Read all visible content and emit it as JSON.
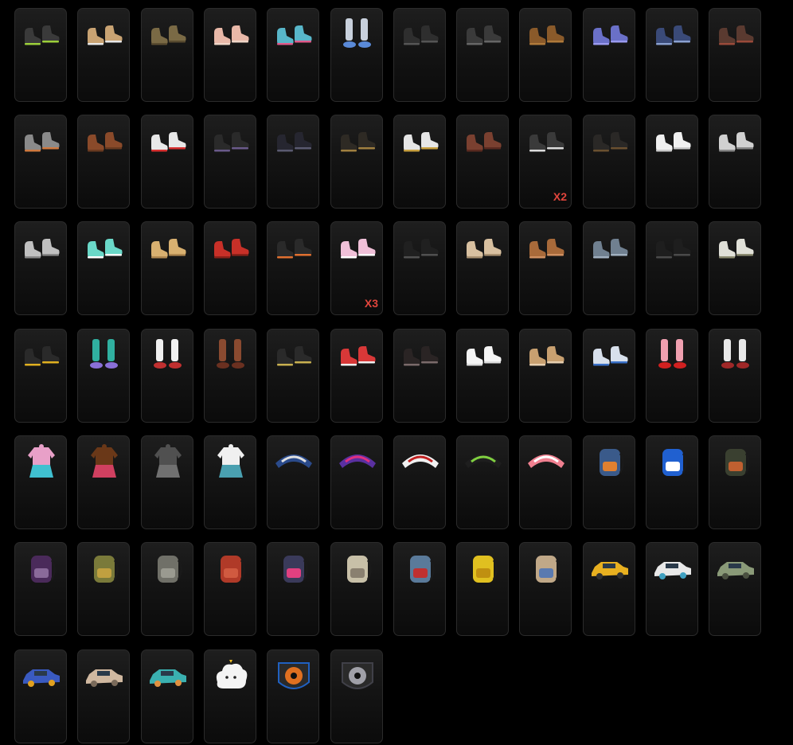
{
  "inventory": {
    "columns": 12,
    "items": [
      {
        "kind": "shoes",
        "icon": "black-green-sneakers-icon",
        "color": "#3a3a3a",
        "accent": "#9ccf3a"
      },
      {
        "kind": "shoes",
        "icon": "tan-boots-icon",
        "color": "#c9a373",
        "accent": "#e8e8e8"
      },
      {
        "kind": "shoes",
        "icon": "brown-combat-boots-icon",
        "color": "#7a6a45",
        "accent": "#5a4c30"
      },
      {
        "kind": "shoes",
        "icon": "pink-sandals-icon",
        "color": "#e8b8a8",
        "accent": "#f0d6c8"
      },
      {
        "kind": "shoes",
        "icon": "blue-slippers-icon",
        "color": "#58b6c9",
        "accent": "#e05a8a"
      },
      {
        "kind": "socks",
        "icon": "white-stockings-icon",
        "color": "#c8d0dc",
        "accent": "#5a8ad8"
      },
      {
        "kind": "shoes",
        "icon": "black-loafers-icon",
        "color": "#2e2e2e",
        "accent": "#555555"
      },
      {
        "kind": "shoes",
        "icon": "dark-loafers-icon",
        "color": "#3a3a3a",
        "accent": "#666666"
      },
      {
        "kind": "shoes",
        "icon": "brown-gloves-shoes-icon",
        "color": "#8a5a2a",
        "accent": "#b07a3a"
      },
      {
        "kind": "shoes",
        "icon": "purple-heels-icon",
        "color": "#6a70c8",
        "accent": "#9a9af0"
      },
      {
        "kind": "shoes",
        "icon": "navy-sneakers-icon",
        "color": "#3a4a78",
        "accent": "#8aa0d0"
      },
      {
        "kind": "shoes",
        "icon": "red-brown-boots-icon",
        "color": "#5a3a30",
        "accent": "#9a4a3a"
      },
      {
        "kind": "shoes",
        "icon": "gray-orange-sneakers-icon",
        "color": "#8a8a8a",
        "accent": "#d07a40"
      },
      {
        "kind": "shoes",
        "icon": "brown-tall-boots-icon",
        "color": "#8a4a2a",
        "accent": "#6a3a20"
      },
      {
        "kind": "shoes",
        "icon": "white-red-sneakers-icon",
        "color": "#e8e8e8",
        "accent": "#d83030"
      },
      {
        "kind": "shoes",
        "icon": "black-ankle-boots-icon",
        "color": "#2a2a2a",
        "accent": "#6a5a8a"
      },
      {
        "kind": "shoes",
        "icon": "black-shoes-icon",
        "color": "#262630",
        "accent": "#5a5a70"
      },
      {
        "kind": "shoes",
        "icon": "black-gold-boots-icon",
        "color": "#2e2a24",
        "accent": "#a08040"
      },
      {
        "kind": "shoes",
        "icon": "white-gold-boots-icon",
        "color": "#e6e6e6",
        "accent": "#c8a040"
      },
      {
        "kind": "shoes",
        "icon": "brown-thigh-boots-icon",
        "color": "#7a4030",
        "accent": "#5a2a20"
      },
      {
        "kind": "shoes",
        "icon": "black-white-sneakers-icon",
        "color": "#3a3a3a",
        "accent": "#dcdcdc",
        "badge": "X2"
      },
      {
        "kind": "shoes",
        "icon": "black-boots-icon",
        "color": "#2a2826",
        "accent": "#6a5030"
      },
      {
        "kind": "shoes",
        "icon": "white-flats-icon",
        "color": "#f0f0f0",
        "accent": "#cccccc"
      },
      {
        "kind": "shoes",
        "icon": "white-high-boots-icon",
        "color": "#d0d0d0",
        "accent": "#888888"
      },
      {
        "kind": "shoes",
        "icon": "gray-sneakers-icon",
        "color": "#c0c0c0",
        "accent": "#888888"
      },
      {
        "kind": "shoes",
        "icon": "mint-slides-icon",
        "color": "#6ad8c8",
        "accent": "#ffffff"
      },
      {
        "kind": "shoes",
        "icon": "tan-sneakers-icon",
        "color": "#d8b070",
        "accent": "#b08850"
      },
      {
        "kind": "shoes",
        "icon": "red-boots-icon",
        "color": "#c83028",
        "accent": "#8a2018"
      },
      {
        "kind": "shoes",
        "icon": "black-orange-sneakers-icon",
        "color": "#2a2a2a",
        "accent": "#e07030"
      },
      {
        "kind": "shoes",
        "icon": "pink-socks-white-shoes-icon",
        "color": "#f0c0d8",
        "accent": "#ffffff",
        "badge": "X3"
      },
      {
        "kind": "shoes",
        "icon": "black-leather-boots-icon",
        "color": "#202020",
        "accent": "#505050"
      },
      {
        "kind": "shoes",
        "icon": "beige-fur-boots-icon",
        "color": "#d8c0a0",
        "accent": "#a89070"
      },
      {
        "kind": "shoes",
        "icon": "brown-moccasins-icon",
        "color": "#a86a3a",
        "accent": "#d09060"
      },
      {
        "kind": "shoes",
        "icon": "slate-boots-icon",
        "color": "#708090",
        "accent": "#a0b0c0"
      },
      {
        "kind": "shoes",
        "icon": "black-combat-boots-icon",
        "color": "#1e1e1e",
        "accent": "#4a4a4a"
      },
      {
        "kind": "shoes",
        "icon": "white-camo-slides-icon",
        "color": "#e0e0d8",
        "accent": "#8a8a70"
      },
      {
        "kind": "shoes",
        "icon": "black-yellow-boots-icon",
        "color": "#2a2a2a",
        "accent": "#e0b020"
      },
      {
        "kind": "socks",
        "icon": "checkered-socks-purple-shoes-icon",
        "color": "#30b0a0",
        "accent": "#8a70d8"
      },
      {
        "kind": "socks",
        "icon": "striped-socks-sandals-icon",
        "color": "#f0f0f0",
        "accent": "#c03030"
      },
      {
        "kind": "socks",
        "icon": "brown-stockings-icon",
        "color": "#8a4a30",
        "accent": "#6a3020"
      },
      {
        "kind": "shoes",
        "icon": "black-heels-icon",
        "color": "#2a2a2a",
        "accent": "#c8b050"
      },
      {
        "kind": "shoes",
        "icon": "red-white-sneakers-icon",
        "color": "#d83838",
        "accent": "#f0f0f0"
      },
      {
        "kind": "shoes",
        "icon": "black-lace-boots-icon",
        "color": "#2a2424",
        "accent": "#7a6a6a"
      },
      {
        "kind": "shoes",
        "icon": "white-sneakers-icon",
        "color": "#f4f4f4",
        "accent": "#dddddd"
      },
      {
        "kind": "shoes",
        "icon": "tan-strap-sandals-icon",
        "color": "#c8a070",
        "accent": "#e8d0b0"
      },
      {
        "kind": "shoes",
        "icon": "blue-white-sneakers-icon",
        "color": "#d8e0ec",
        "accent": "#3a70c8"
      },
      {
        "kind": "socks",
        "icon": "pink-socks-red-shoes-icon",
        "color": "#f0a0b0",
        "accent": "#d02020"
      },
      {
        "kind": "socks",
        "icon": "white-socks-red-shoes-icon",
        "color": "#e8e8e8",
        "accent": "#a02828"
      },
      {
        "kind": "outfit",
        "icon": "pink-jacket-skirt-icon",
        "color": "#e8a0c8",
        "accent": "#40c0d0"
      },
      {
        "kind": "outfit",
        "icon": "brown-jumpsuit-icon",
        "color": "#6a3818",
        "accent": "#d04060"
      },
      {
        "kind": "outfit",
        "icon": "gray-tactical-suit-icon",
        "color": "#505050",
        "accent": "#707070"
      },
      {
        "kind": "outfit",
        "icon": "white-top-sequin-skirt-icon",
        "color": "#f0f0f0",
        "accent": "#4aa0b0"
      },
      {
        "kind": "glider",
        "icon": "blue-glider-icon",
        "color": "#2a4a8a",
        "accent": "#e0e0e0"
      },
      {
        "kind": "glider",
        "icon": "purple-floral-glider-icon",
        "color": "#5a30a0",
        "accent": "#e03080"
      },
      {
        "kind": "glider",
        "icon": "white-graffiti-glider-icon",
        "color": "#f0f0f0",
        "accent": "#c02020"
      },
      {
        "kind": "glider",
        "icon": "black-green-glider-icon",
        "color": "#1e1e1e",
        "accent": "#80d040"
      },
      {
        "kind": "glider",
        "icon": "pink-cartoon-glider-icon",
        "color": "#f08090",
        "accent": "#ffffff"
      },
      {
        "kind": "backpack",
        "icon": "blue-orange-backpack-icon",
        "color": "#3a5a8a",
        "accent": "#e08030"
      },
      {
        "kind": "backpack",
        "icon": "blue-white-backpack-icon",
        "color": "#2060d0",
        "accent": "#ffffff"
      },
      {
        "kind": "backpack",
        "icon": "dark-camo-backpack-icon",
        "color": "#3a4030",
        "accent": "#c06030"
      },
      {
        "kind": "backpack",
        "icon": "purple-backpack-icon",
        "color": "#4a2a5a",
        "accent": "#8a6a9a"
      },
      {
        "kind": "backpack",
        "icon": "olive-patched-backpack-icon",
        "color": "#7a7a3a",
        "accent": "#c0a040"
      },
      {
        "kind": "backpack",
        "icon": "gray-backpack-icon",
        "color": "#707068",
        "accent": "#9a9a90"
      },
      {
        "kind": "backpack",
        "icon": "red-backpack-icon",
        "color": "#b03a28",
        "accent": "#d05a40"
      },
      {
        "kind": "backpack",
        "icon": "graffiti-backpack-icon",
        "color": "#3a3a5a",
        "accent": "#e04080"
      },
      {
        "kind": "backpack",
        "icon": "beige-backpack-icon",
        "color": "#c8c0a8",
        "accent": "#8a8070"
      },
      {
        "kind": "backpack",
        "icon": "shark-backpack-icon",
        "color": "#5a7a9a",
        "accent": "#c03030"
      },
      {
        "kind": "backpack",
        "icon": "yellow-backpack-icon",
        "color": "#e0c020",
        "accent": "#c09010"
      },
      {
        "kind": "backpack",
        "icon": "striped-sack-backpack-icon",
        "color": "#c0a888",
        "accent": "#5a7ab0"
      },
      {
        "kind": "vehicle",
        "icon": "yellow-taxi-car-icon",
        "color": "#e8b020",
        "accent": "#303030"
      },
      {
        "kind": "vehicle",
        "icon": "white-bus-icon",
        "color": "#e8e8e8",
        "accent": "#40a0c0"
      },
      {
        "kind": "vehicle",
        "icon": "olive-jeep-icon",
        "color": "#8a9a78",
        "accent": "#4a5040"
      },
      {
        "kind": "vehicle",
        "icon": "blue-graffiti-car-icon",
        "color": "#3a5ac0",
        "accent": "#e0a020"
      },
      {
        "kind": "vehicle",
        "icon": "beige-sedan-icon",
        "color": "#d0b8a0",
        "accent": "#7a6a5a"
      },
      {
        "kind": "vehicle",
        "icon": "teal-speedboat-icon",
        "color": "#3ab0b0",
        "accent": "#e09040"
      },
      {
        "kind": "pendant",
        "icon": "cloud-charm-icon",
        "color": "#f4f4f4",
        "accent": "#f0c020"
      },
      {
        "kind": "emblem",
        "icon": "flaming-wheel-emblem-icon",
        "color": "#e07020",
        "accent": "#2060c0"
      },
      {
        "kind": "emblem",
        "icon": "chrome-wheel-emblem-icon",
        "color": "#a0a0a8",
        "accent": "#404048"
      }
    ]
  }
}
